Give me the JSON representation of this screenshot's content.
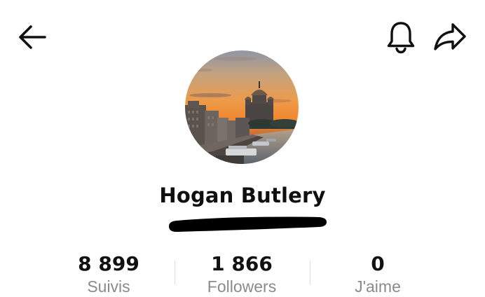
{
  "header": {
    "back_icon": "arrow-left-icon",
    "notification_icon": "bell-icon",
    "share_icon": "share-arrow-icon"
  },
  "profile": {
    "avatar_icon": "avatar-photo-cathedral-sunset",
    "display_name": "Hogan Butlery",
    "username_redacted": true
  },
  "stats": [
    {
      "value": "8 899",
      "label": "Suivis"
    },
    {
      "value": "1 866",
      "label": "Followers"
    },
    {
      "value": "0",
      "label": "J'aime"
    }
  ],
  "colors": {
    "background": "#ffffff",
    "text_primary": "#111111",
    "text_secondary": "#8a8a8a",
    "redaction": "#000000"
  }
}
